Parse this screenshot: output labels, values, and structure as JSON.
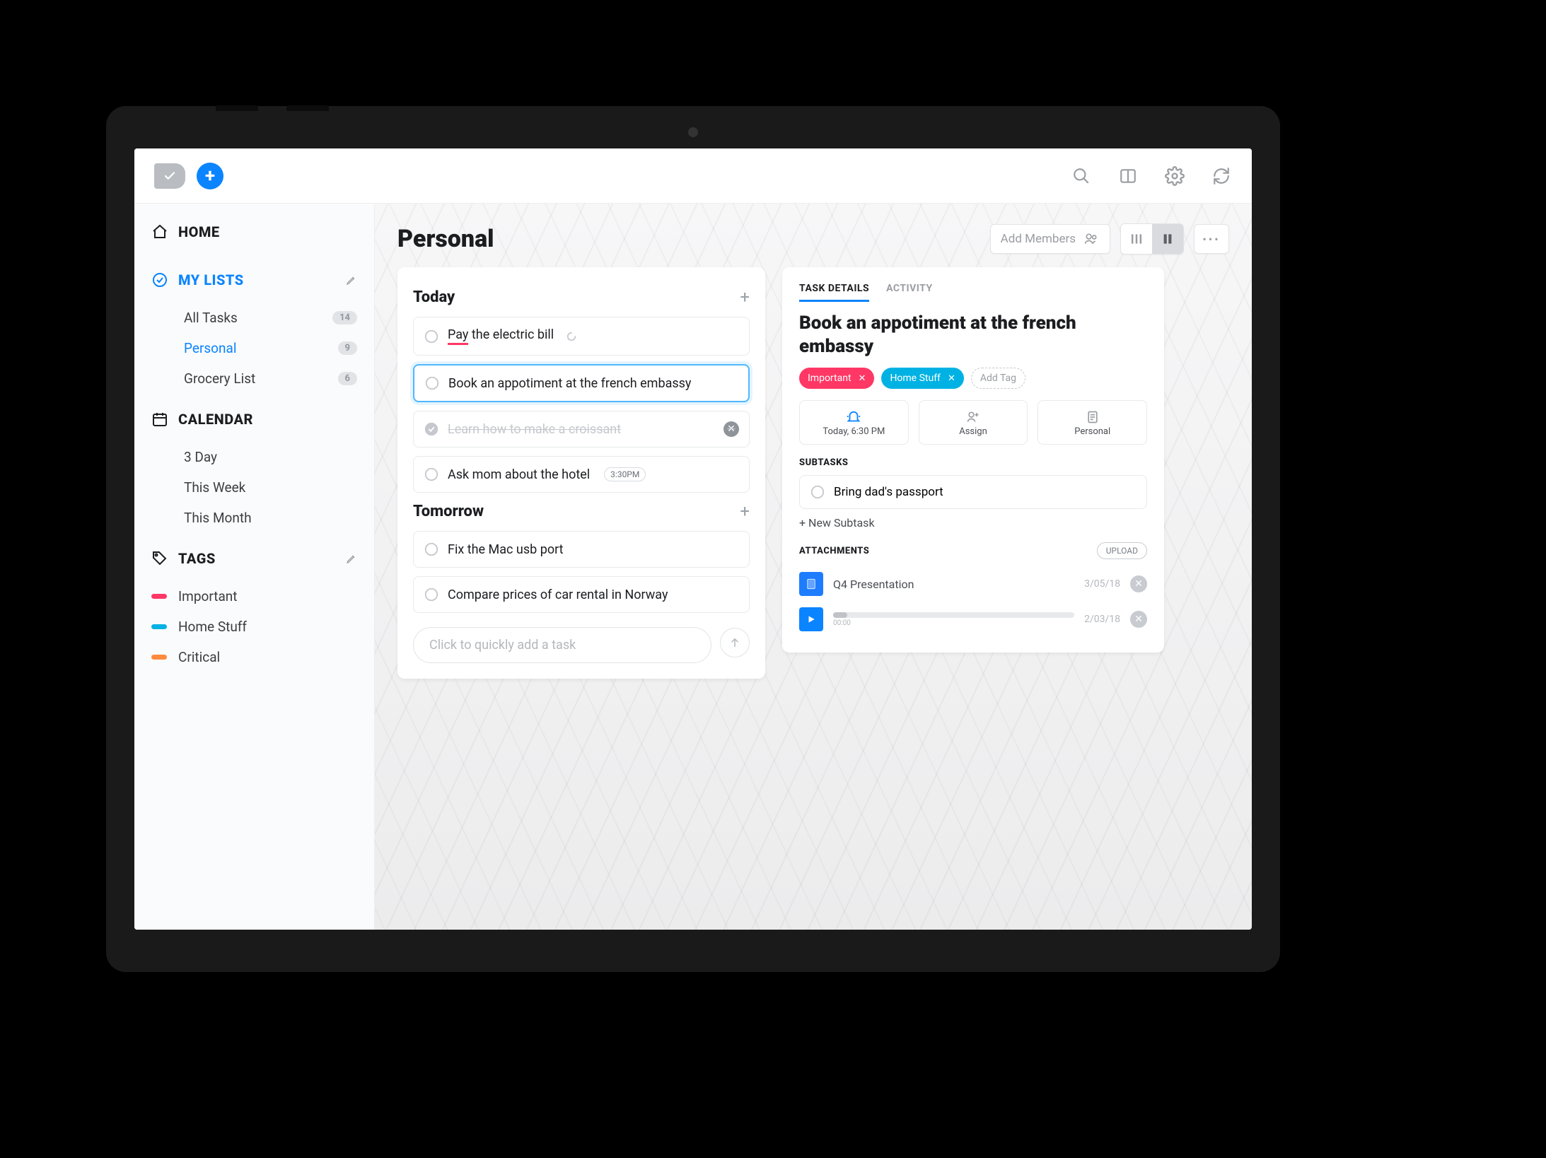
{
  "accent": "#0a84ff",
  "sidebar": {
    "home_label": "HOME",
    "mylists_label": "MY LISTS",
    "items": [
      {
        "label": "All Tasks",
        "count": "14",
        "active": false
      },
      {
        "label": "Personal",
        "count": "9",
        "active": true
      },
      {
        "label": "Grocery List",
        "count": "6",
        "active": false
      }
    ],
    "calendar_label": "CALENDAR",
    "calendar_items": [
      "3 Day",
      "This Week",
      "This Month"
    ],
    "tags_label": "TAGS",
    "tags": [
      {
        "label": "Important",
        "color": "#ff3765"
      },
      {
        "label": "Home Stuff",
        "color": "#00b2e3"
      },
      {
        "label": "Critical",
        "color": "#ff8a3d"
      }
    ]
  },
  "page": {
    "title": "Personal",
    "add_members": "Add Members"
  },
  "groups": {
    "today": {
      "title": "Today",
      "tasks": [
        {
          "text": "Pay the electric bill",
          "flag_red_underline_word": "elec",
          "done": false,
          "loading": true
        },
        {
          "text": "Book an appotiment at the french embassy",
          "selected": true
        },
        {
          "text": "Learn how to make a croissant",
          "done": true
        },
        {
          "text": "Ask mom about the hotel",
          "time": "3:30PM"
        }
      ]
    },
    "tomorrow": {
      "title": "Tomorrow",
      "tasks": [
        {
          "text": "Fix the Mac usb port"
        },
        {
          "text": "Compare prices of car rental in Norway"
        }
      ]
    },
    "quick_add_placeholder": "Click to quickly add a task"
  },
  "details": {
    "tabs": [
      {
        "label": "TASK DETAILS",
        "active": true
      },
      {
        "label": "ACTIVITY",
        "active": false
      }
    ],
    "title": "Book an appotiment at the french embassy",
    "tags": [
      {
        "label": "Important",
        "bg": "#ff3765"
      },
      {
        "label": "Home Stuff",
        "bg": "#00b2e3"
      }
    ],
    "add_tag_label": "Add Tag",
    "meta": {
      "when": "Today, 6:30 PM",
      "assign": "Assign",
      "list": "Personal"
    },
    "subtasks_label": "SUBTASKS",
    "subtasks": [
      {
        "text": "Bring dad's passport"
      }
    ],
    "new_subtask": "+ New Subtask",
    "attachments_label": "ATTACHMENTS",
    "upload_label": "UPLOAD",
    "attachments": [
      {
        "kind": "doc",
        "name": "Q4 Presentation",
        "date": "3/05/18",
        "thumb_bg": "#1e7dff"
      },
      {
        "kind": "audio",
        "name": "",
        "date": "2/03/18",
        "thumb_bg": "#0a84ff",
        "time": "00:00"
      }
    ]
  }
}
